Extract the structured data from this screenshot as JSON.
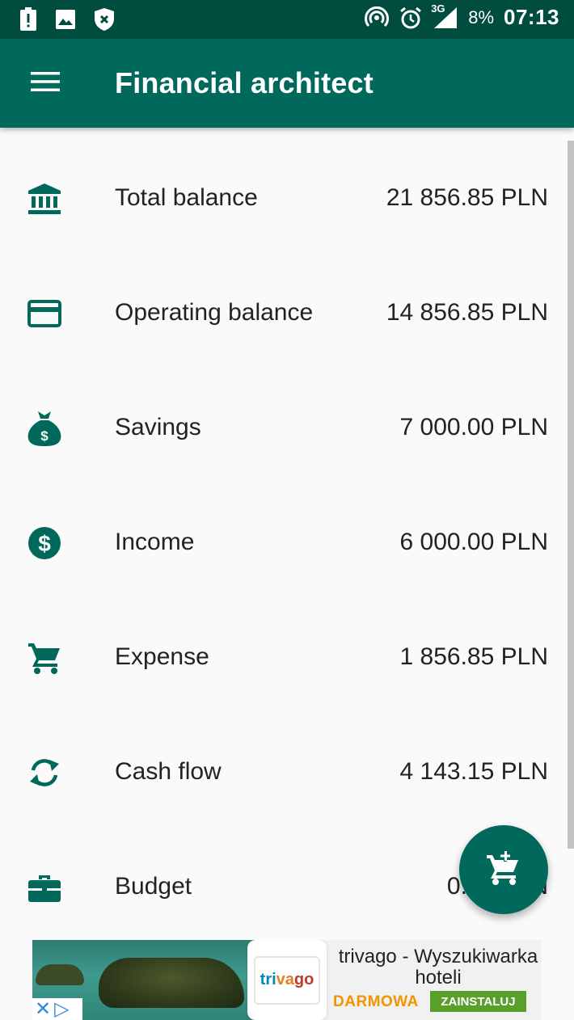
{
  "status_bar": {
    "battery_percent": "8%",
    "time": "07:13",
    "network": "3G"
  },
  "app_bar": {
    "title": "Financial architect"
  },
  "summary": [
    {
      "label": "Total balance",
      "value": "21 856.85 PLN",
      "icon": "bank-icon"
    },
    {
      "label": "Operating balance",
      "value": "14 856.85 PLN",
      "icon": "credit-card-icon"
    },
    {
      "label": "Savings",
      "value": "7 000.00 PLN",
      "icon": "money-bag-icon"
    },
    {
      "label": "Income",
      "value": "6 000.00 PLN",
      "icon": "dollar-circle-icon"
    },
    {
      "label": "Expense",
      "value": "1 856.85 PLN",
      "icon": "cart-icon"
    },
    {
      "label": "Cash flow",
      "value": "4 143.15 PLN",
      "icon": "cash-flow-icon"
    },
    {
      "label": "Budget",
      "value": "0.00 PLN",
      "icon": "briefcase-icon"
    }
  ],
  "fab": {
    "icon": "add-to-cart-icon"
  },
  "ad": {
    "brand": "trivago",
    "title": "trivago - Wyszukiwarka hoteli",
    "price": "DARMOWA",
    "cta": "ZAINSTALUJ"
  },
  "colors": {
    "primary": "#00695c",
    "primary_dark": "#004d40",
    "accent_icon": "#00695c",
    "background": "#fafafa"
  }
}
